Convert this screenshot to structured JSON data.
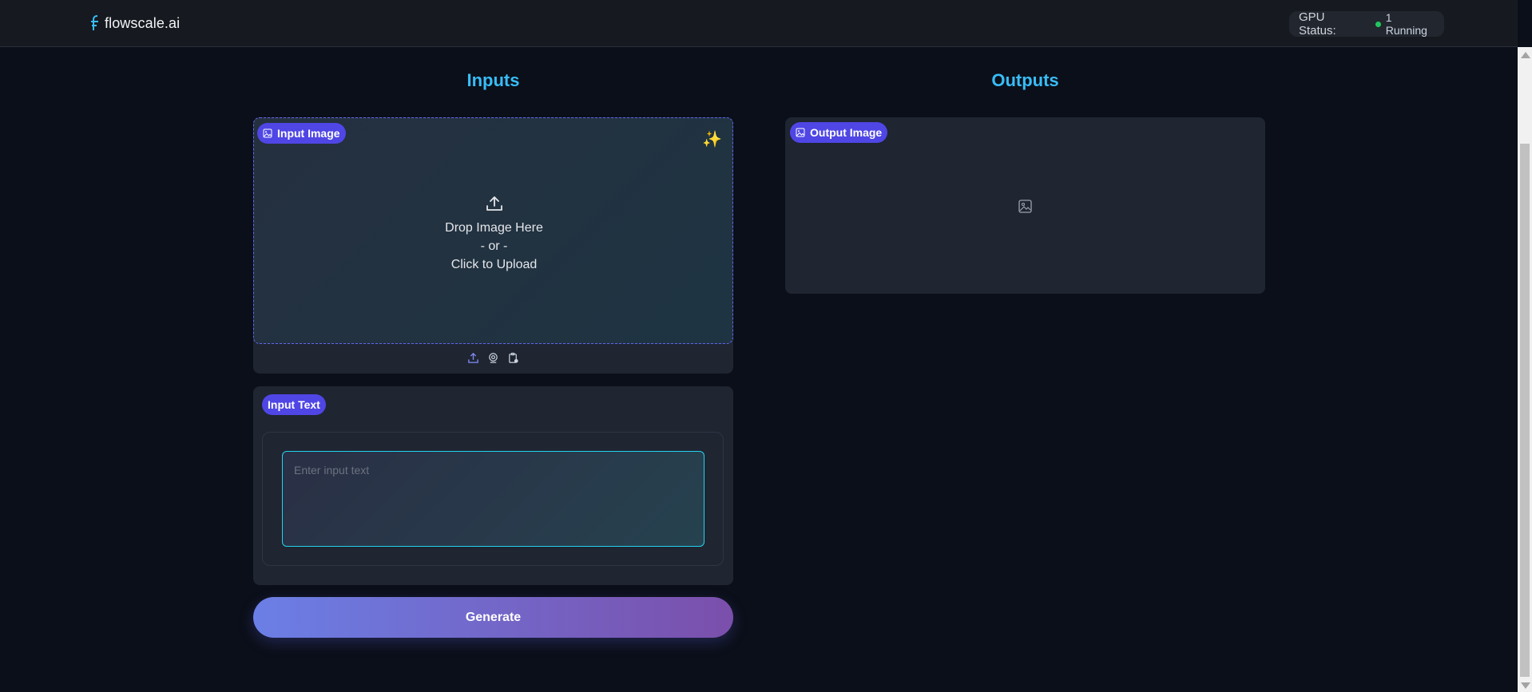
{
  "header": {
    "brand": "flowscale.ai",
    "gpu_status_label": "GPU Status:",
    "gpu_running": "1 Running",
    "status_color": "#22c55e"
  },
  "main": {
    "inputs_title": "Inputs",
    "outputs_title": "Outputs",
    "input_image": {
      "label": "Input Image",
      "drop_line1": "Drop Image Here",
      "drop_line2": "- or -",
      "drop_line3": "Click to Upload",
      "tools": [
        "upload-icon",
        "webcam-icon",
        "clipboard-icon"
      ]
    },
    "input_text": {
      "label": "Input Text",
      "placeholder": "Enter input text",
      "value": ""
    },
    "generate_label": "Generate",
    "output_image": {
      "label": "Output Image"
    }
  },
  "colors": {
    "accent": "#38bdf8",
    "badge": "#4f46e5",
    "background": "#0b0f19"
  }
}
